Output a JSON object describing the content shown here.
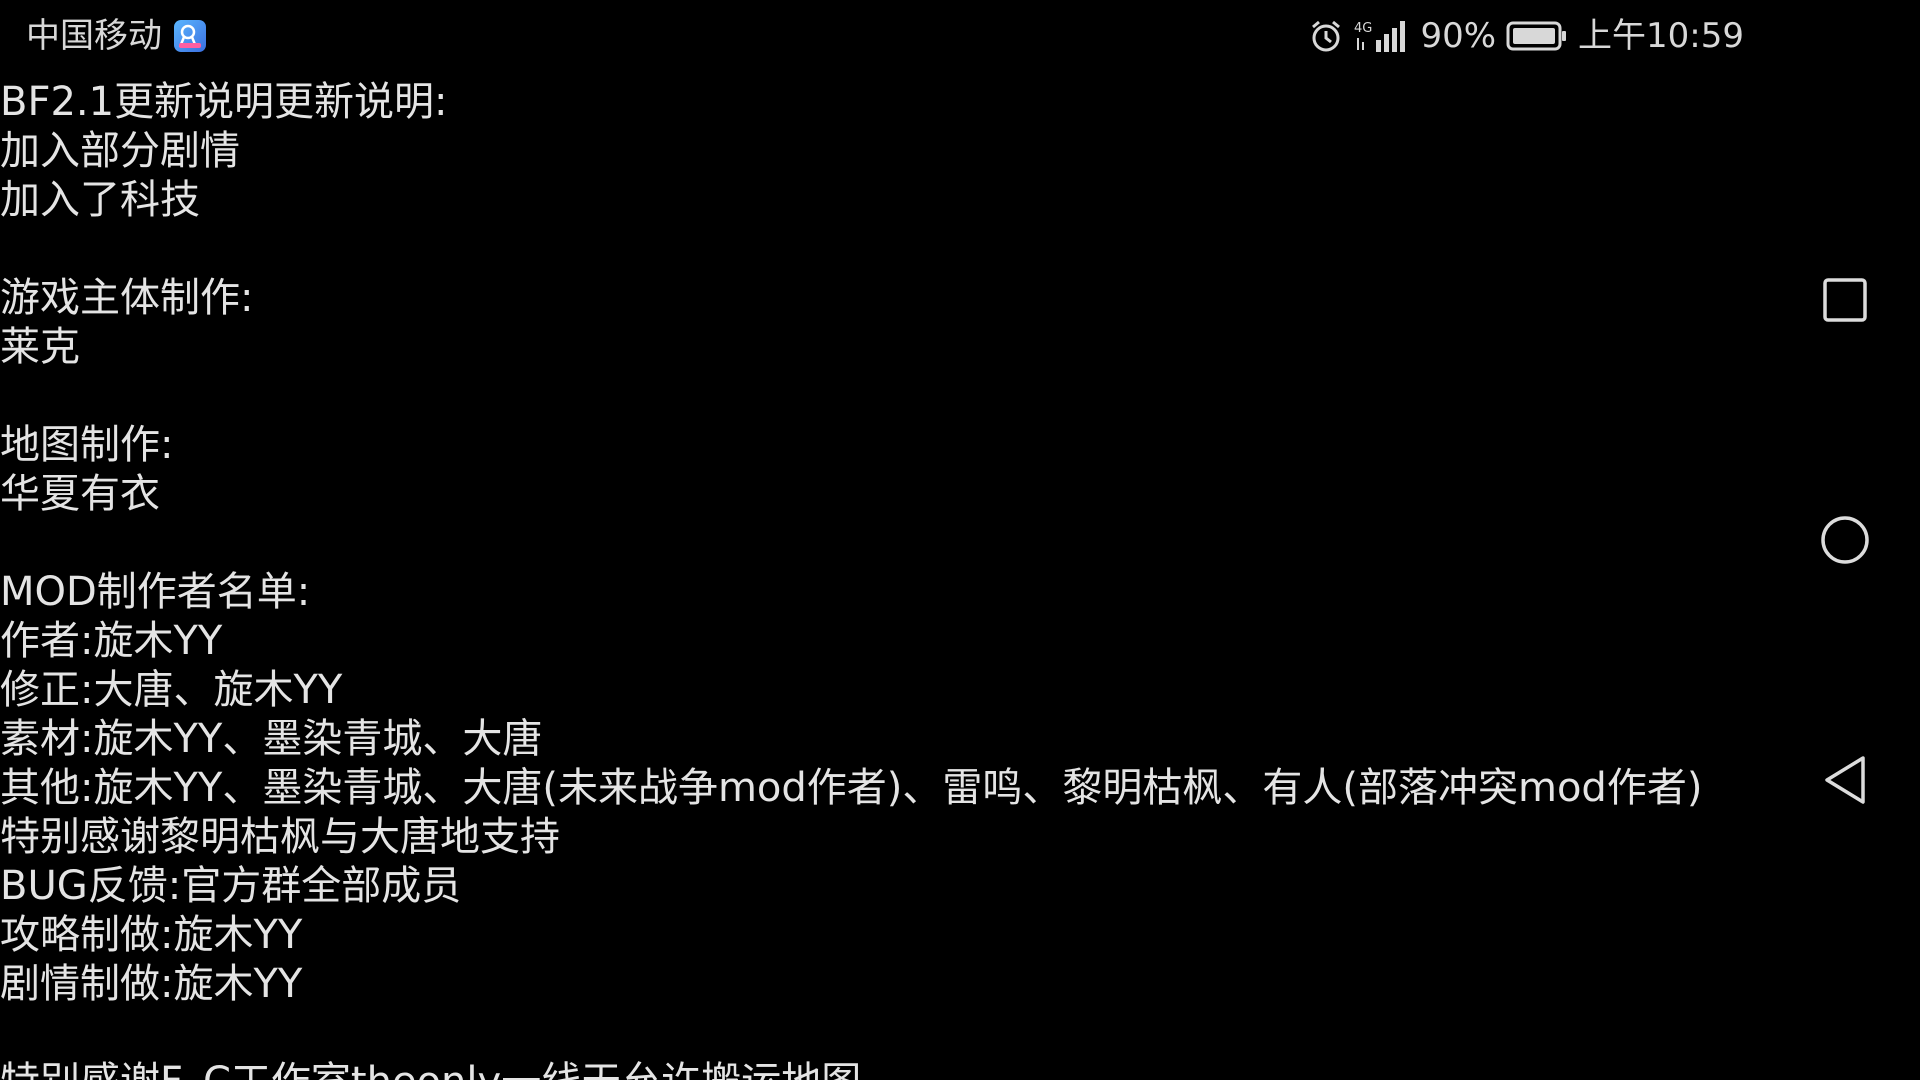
{
  "status_bar": {
    "carrier": "中国移动",
    "network": "4G",
    "battery": "90%",
    "time": "上午10:59",
    "icons": [
      "app-notification-icon",
      "alarm-icon",
      "4g-signal-icon",
      "battery-icon"
    ]
  },
  "content": {
    "line_01": "BF2.1更新说明更新说明:",
    "line_02": "加入部分剧情",
    "line_03": "加入了科技",
    "line_04": "游戏主体制作:",
    "line_05": "莱克",
    "line_06": "地图制作:",
    "line_07": "华夏有衣",
    "line_08": "MOD制作者名单:",
    "line_09": "作者:旋木YY",
    "line_10": "修正:大唐、旋木YY",
    "line_11": "素材:旋木YY、墨染青城、大唐",
    "line_12": "其他:旋木YY、墨染青城、大唐(未来战争mod作者)、雷鸣、黎明枯枫、有人(部落冲突mod作者)",
    "line_13": "特别感谢黎明枯枫与大唐地支持",
    "line_14": "BUG反馈:官方群全部成员",
    "line_15": "攻略制做:旋木YY",
    "line_16": "剧情制做:旋木YY",
    "line_17": "特别感谢F_C工作室theonly一线天允许搬运地图"
  },
  "nav_bar": {
    "buttons": [
      "recent-apps",
      "home",
      "back"
    ]
  },
  "colors": {
    "background": "#000000",
    "text": "#e4e4e4",
    "status_text": "#d8d8d8"
  }
}
